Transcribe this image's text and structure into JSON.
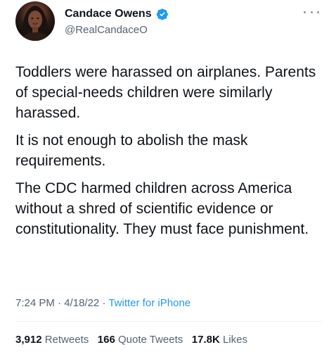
{
  "author": {
    "display_name": "Candace Owens",
    "handle": "@RealCandaceO",
    "verified": true,
    "avatar_icon": "profile-photo"
  },
  "tweet": {
    "paragraphs": [
      "Toddlers were harassed on airplanes. Parents of special-needs children were similarly harassed.",
      "It is not enough to abolish the mask requirements.",
      "The CDC harmed children across America without a shred of scientific evidence or constitutionality. They must face punishment."
    ],
    "time": "7:24 PM",
    "date": "4/18/22",
    "source": "Twitter for iPhone",
    "separator": "·"
  },
  "stats": {
    "retweets_count": "3,912",
    "retweets_label": "Retweets",
    "quotes_count": "166",
    "quotes_label": "Quote Tweets",
    "likes_count": "17.8K",
    "likes_label": "Likes"
  },
  "colors": {
    "link": "#1d9bf0",
    "verified": "#1d9bf0",
    "secondary_text": "#536471",
    "primary_text": "#0f1419"
  }
}
